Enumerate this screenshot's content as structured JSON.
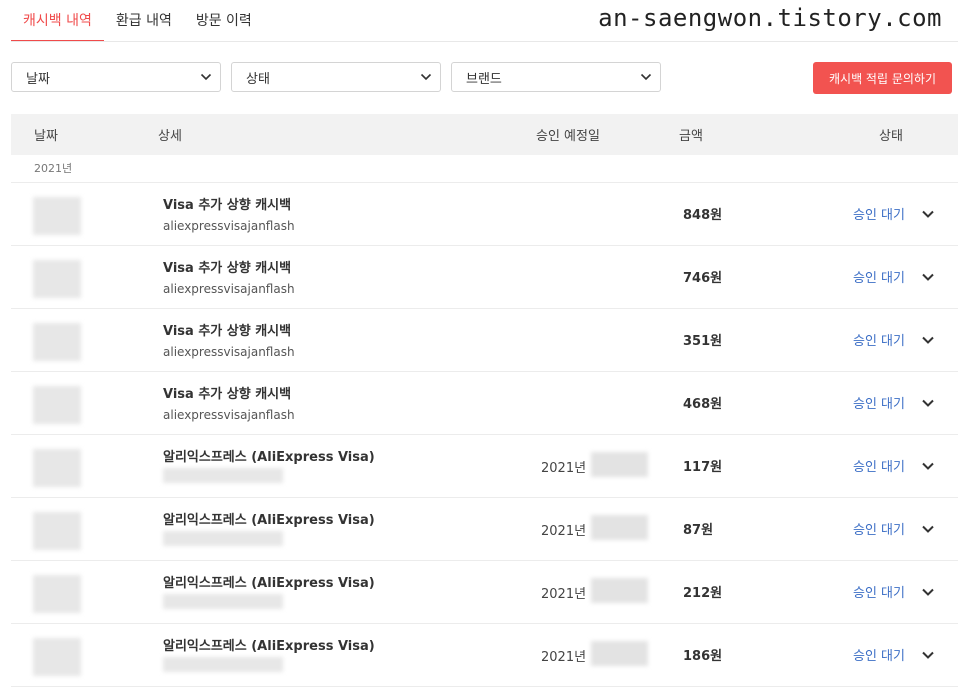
{
  "tabs": [
    {
      "label": "캐시백 내역",
      "active": true
    },
    {
      "label": "환급 내역",
      "active": false
    },
    {
      "label": "방문 이력",
      "active": false
    }
  ],
  "watermark": "an-saengwon.tistory.com",
  "filters": [
    {
      "label": "날짜"
    },
    {
      "label": "상태"
    },
    {
      "label": "브랜드"
    }
  ],
  "inquiry_button": "캐시백 적립 문의하기",
  "table": {
    "headers": {
      "date": "날짜",
      "detail": "상세",
      "expected_date": "승인 예정일",
      "amount": "금액",
      "status": "상태"
    },
    "year_group": "2021년",
    "rows": [
      {
        "title": "Visa 추가 상향 캐시백",
        "subtitle": "aliexpressvisajanflash",
        "expected": "",
        "amount": "848원",
        "status": "승인 대기"
      },
      {
        "title": "Visa 추가 상향 캐시백",
        "subtitle": "aliexpressvisajanflash",
        "expected": "",
        "amount": "746원",
        "status": "승인 대기"
      },
      {
        "title": "Visa 추가 상향 캐시백",
        "subtitle": "aliexpressvisajanflash",
        "expected": "",
        "amount": "351원",
        "status": "승인 대기"
      },
      {
        "title": "Visa 추가 상향 캐시백",
        "subtitle": "aliexpressvisajanflash",
        "expected": "",
        "amount": "468원",
        "status": "승인 대기"
      },
      {
        "title": "알리익스프레스 (AliExpress Visa)",
        "subtitle": "",
        "expected": "2021년",
        "amount": "117원",
        "status": "승인 대기"
      },
      {
        "title": "알리익스프레스 (AliExpress Visa)",
        "subtitle": "",
        "expected": "2021년",
        "amount": "87원",
        "status": "승인 대기"
      },
      {
        "title": "알리익스프레스 (AliExpress Visa)",
        "subtitle": "",
        "expected": "2021년",
        "amount": "212원",
        "status": "승인 대기"
      },
      {
        "title": "알리익스프레스 (AliExpress Visa)",
        "subtitle": "",
        "expected": "2021년",
        "amount": "186원",
        "status": "승인 대기"
      }
    ]
  },
  "colors": {
    "accent": "#f04b4b",
    "button": "#f25350",
    "status_link": "#3d6fc6"
  },
  "icons": {
    "select": "chevron-down-icon",
    "row": "chevron-down-icon"
  }
}
